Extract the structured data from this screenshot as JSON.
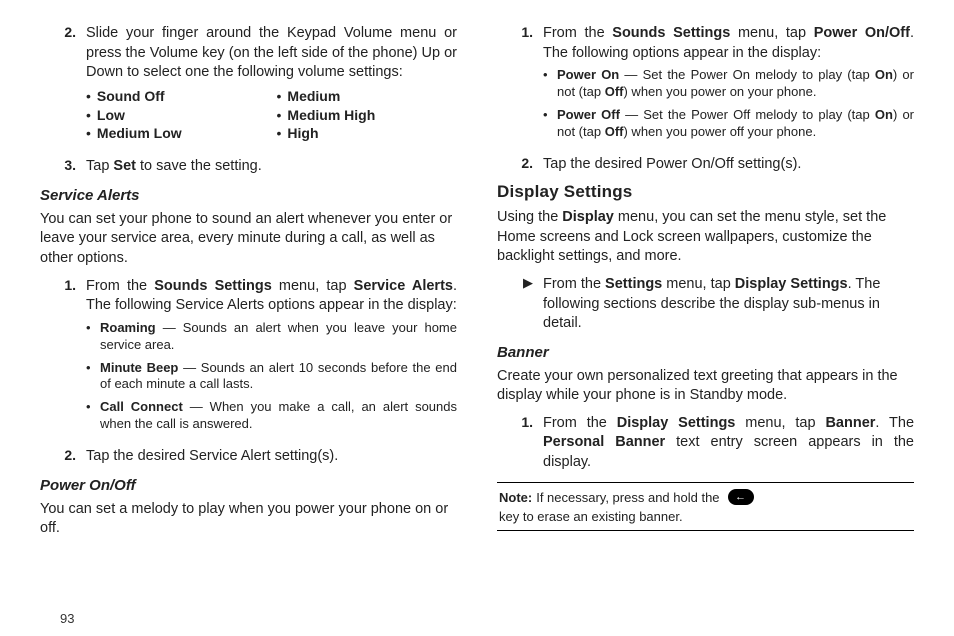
{
  "pageNumber": "93",
  "left": {
    "step2": {
      "num": "2.",
      "text_a": "Slide your finger around the Keypad Volume menu or press the Volume key (on the left side of the phone) Up or Down to select one the following volume settings:"
    },
    "vol": [
      [
        "Sound Off",
        "Medium"
      ],
      [
        "Low",
        "Medium High"
      ],
      [
        "Medium Low",
        "High"
      ]
    ],
    "step3": {
      "num": "3.",
      "pre": "Tap ",
      "b": "Set",
      "post": " to save the setting."
    },
    "serviceAlerts": {
      "heading": "Service Alerts",
      "intro": "You can set your phone to sound an alert whenever you enter or leave your service area, every minute during a call, as well as other options.",
      "s1": {
        "num": "1.",
        "pre": "From the ",
        "b1": "Sounds Settings",
        "mid": " menu, tap ",
        "b2": "Service Alerts",
        "end": ". The following Service Alerts options appear in the display:"
      },
      "bullets": [
        {
          "b": "Roaming",
          "t": " — Sounds an alert when you leave your home service area."
        },
        {
          "b": "Minute Beep",
          "t": " — Sounds an alert 10 seconds before the end of each minute a call lasts."
        },
        {
          "b": "Call Connect",
          "t": " — When you make a call, an alert sounds when the call is answered."
        }
      ],
      "s2": {
        "num": "2.",
        "text": "Tap the desired Service Alert setting(s)."
      }
    },
    "powerHeading": "Power On/Off",
    "powerIntro": "You can set a melody to play when you power your phone on or off."
  },
  "right": {
    "s1": {
      "num": "1.",
      "pre": "From the ",
      "b1": "Sounds Settings",
      "mid": " menu, tap ",
      "b2": "Power On/Off",
      "end": ". The following options appear in the display:"
    },
    "bullets": [
      {
        "b": "Power On",
        "t1": " — Set the Power On melody to play (tap ",
        "on": "On",
        "t2": ") or not (tap ",
        "off": "Off",
        "t3": ") when you power on your phone."
      },
      {
        "b": "Power Off",
        "t1": " — Set the Power Off melody to play (tap ",
        "on": "On",
        "t2": ") or not (tap ",
        "off": "Off",
        "t3": ") when you power off your phone."
      }
    ],
    "s2": {
      "num": "2.",
      "text": "Tap the desired Power On/Off setting(s)."
    },
    "display": {
      "heading": "Display Settings",
      "intro_pre": "Using the ",
      "intro_b": "Display",
      "intro_post": " menu, you can set the menu style, set the Home screens and Lock screen wallpapers, customize the backlight settings, and more.",
      "arrow": {
        "pre": "From the ",
        "b1": "Settings",
        "mid": " menu, tap ",
        "b2": "Display Settings",
        "end": ". The following sections describe the display sub-menus in detail."
      }
    },
    "banner": {
      "heading": "Banner",
      "intro": "Create your own personalized text greeting that appears in the display while your phone is in Standby mode.",
      "s1": {
        "num": "1.",
        "pre": "From the ",
        "b1": "Display Settings",
        "mid": " menu, tap ",
        "b2": "Banner",
        "end1": ". The ",
        "b3": "Personal Banner",
        "end2": " text entry screen appears in the display."
      }
    },
    "note": {
      "lead": "Note:",
      "pre": " If necessary, press and hold the ",
      "keyGlyph": "←",
      "post": " key to erase an existing banner."
    }
  }
}
